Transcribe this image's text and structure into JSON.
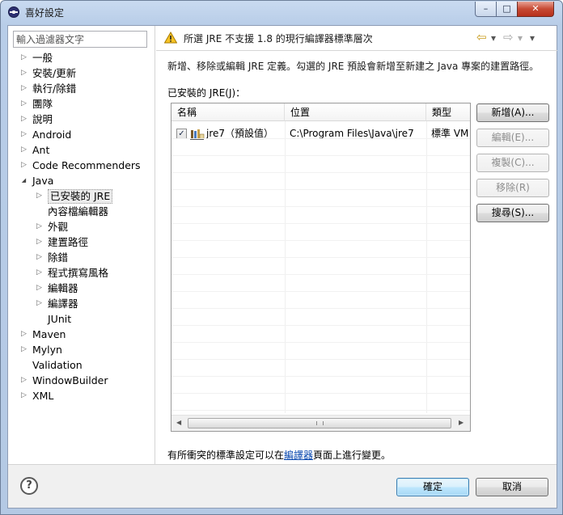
{
  "window": {
    "title": "喜好設定",
    "minimize": "–",
    "maximize": "□",
    "close": "✕"
  },
  "filter": {
    "placeholder": "輸入過濾器文字"
  },
  "tree": {
    "items": [
      {
        "label": "一般",
        "level": 0,
        "twisty": "closed"
      },
      {
        "label": "安裝/更新",
        "level": 0,
        "twisty": "closed"
      },
      {
        "label": "執行/除錯",
        "level": 0,
        "twisty": "closed"
      },
      {
        "label": "團隊",
        "level": 0,
        "twisty": "closed"
      },
      {
        "label": "說明",
        "level": 0,
        "twisty": "closed"
      },
      {
        "label": "Android",
        "level": 0,
        "twisty": "closed"
      },
      {
        "label": "Ant",
        "level": 0,
        "twisty": "closed"
      },
      {
        "label": "Code Recommenders",
        "level": 0,
        "twisty": "closed"
      },
      {
        "label": "Java",
        "level": 0,
        "twisty": "open"
      },
      {
        "label": "已安裝的 JRE",
        "level": 1,
        "twisty": "closed",
        "selected": true
      },
      {
        "label": "內容檔編輯器",
        "level": 1,
        "twisty": "none"
      },
      {
        "label": "外觀",
        "level": 1,
        "twisty": "closed"
      },
      {
        "label": "建置路徑",
        "level": 1,
        "twisty": "closed"
      },
      {
        "label": "除錯",
        "level": 1,
        "twisty": "closed"
      },
      {
        "label": "程式撰寫風格",
        "level": 1,
        "twisty": "closed"
      },
      {
        "label": "編輯器",
        "level": 1,
        "twisty": "closed"
      },
      {
        "label": "編譯器",
        "level": 1,
        "twisty": "closed"
      },
      {
        "label": "JUnit",
        "level": 1,
        "twisty": "none"
      },
      {
        "label": "Maven",
        "level": 0,
        "twisty": "closed"
      },
      {
        "label": "Mylyn",
        "level": 0,
        "twisty": "closed"
      },
      {
        "label": "Validation",
        "level": 0,
        "twisty": "none"
      },
      {
        "label": "WindowBuilder",
        "level": 0,
        "twisty": "closed"
      },
      {
        "label": "XML",
        "level": 0,
        "twisty": "closed"
      }
    ]
  },
  "page": {
    "warning": "所選 JRE 不支援 1.8 的現行編譯器標準層次",
    "description": "新增、移除或編輯 JRE 定義。勾選的 JRE 預設會新增至新建之 Java 專案的建置路徑。",
    "group_label": "已安裝的 JRE(J)：",
    "nav": {
      "back": "⇦",
      "back_menu": "▾",
      "forward": "⇨",
      "forward_menu": "▾",
      "view_menu": "▾"
    },
    "table": {
      "columns": [
        "名稱",
        "位置",
        "類型"
      ],
      "rows": [
        {
          "checked": true,
          "check_mark": "✓",
          "name": "jre7（預設值）",
          "location": "C:\\Program Files\\Java\\jre7",
          "type": "標準 VM"
        }
      ],
      "scroll_left": "◀",
      "scroll_right": "▶"
    },
    "buttons": {
      "add": "新增(A)...",
      "edit": "編輯(E)...",
      "duplicate": "複製(C)...",
      "remove": "移除(R)",
      "search": "搜尋(S)..."
    },
    "footnote": {
      "prefix": "有所衝突的標準設定可以在",
      "link": "編譯器",
      "suffix": "頁面上進行變更。"
    }
  },
  "bottom": {
    "help": "?",
    "ok": "確定",
    "cancel": "取消"
  }
}
